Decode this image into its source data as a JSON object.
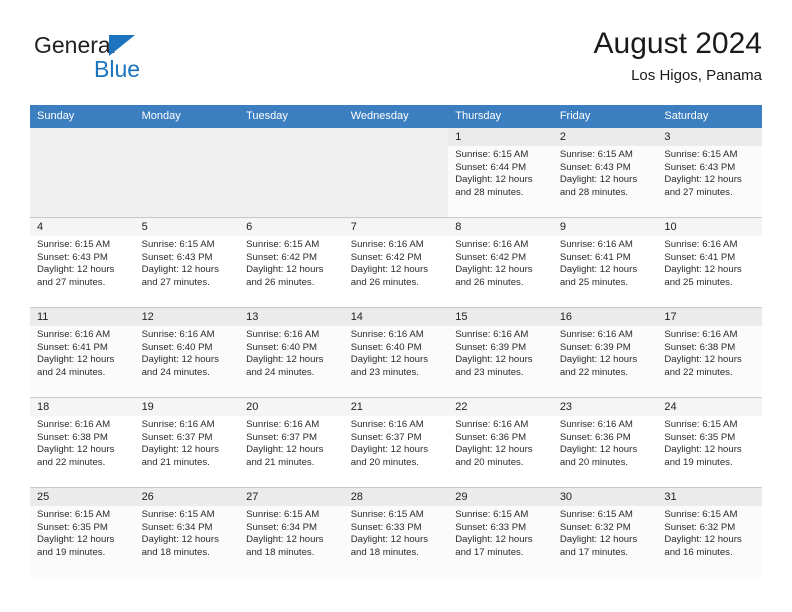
{
  "brand": {
    "name_part1": "General",
    "name_part2": "Blue",
    "logo_icon": "triangle-flag-icon"
  },
  "header": {
    "title": "August 2024",
    "subtitle": "Los Higos, Panama"
  },
  "calendar": {
    "weekday_headers": [
      "Sunday",
      "Monday",
      "Tuesday",
      "Wednesday",
      "Thursday",
      "Friday",
      "Saturday"
    ],
    "accent_color": "#3c7fc1",
    "weeks": [
      [
        {
          "day": "",
          "empty": true
        },
        {
          "day": "",
          "empty": true
        },
        {
          "day": "",
          "empty": true
        },
        {
          "day": "",
          "empty": true
        },
        {
          "day": "1",
          "sunrise": "Sunrise: 6:15 AM",
          "sunset": "Sunset: 6:44 PM",
          "daylight1": "Daylight: 12 hours",
          "daylight2": "and 28 minutes."
        },
        {
          "day": "2",
          "sunrise": "Sunrise: 6:15 AM",
          "sunset": "Sunset: 6:43 PM",
          "daylight1": "Daylight: 12 hours",
          "daylight2": "and 28 minutes."
        },
        {
          "day": "3",
          "sunrise": "Sunrise: 6:15 AM",
          "sunset": "Sunset: 6:43 PM",
          "daylight1": "Daylight: 12 hours",
          "daylight2": "and 27 minutes."
        }
      ],
      [
        {
          "day": "4",
          "sunrise": "Sunrise: 6:15 AM",
          "sunset": "Sunset: 6:43 PM",
          "daylight1": "Daylight: 12 hours",
          "daylight2": "and 27 minutes."
        },
        {
          "day": "5",
          "sunrise": "Sunrise: 6:15 AM",
          "sunset": "Sunset: 6:43 PM",
          "daylight1": "Daylight: 12 hours",
          "daylight2": "and 27 minutes."
        },
        {
          "day": "6",
          "sunrise": "Sunrise: 6:15 AM",
          "sunset": "Sunset: 6:42 PM",
          "daylight1": "Daylight: 12 hours",
          "daylight2": "and 26 minutes."
        },
        {
          "day": "7",
          "sunrise": "Sunrise: 6:16 AM",
          "sunset": "Sunset: 6:42 PM",
          "daylight1": "Daylight: 12 hours",
          "daylight2": "and 26 minutes."
        },
        {
          "day": "8",
          "sunrise": "Sunrise: 6:16 AM",
          "sunset": "Sunset: 6:42 PM",
          "daylight1": "Daylight: 12 hours",
          "daylight2": "and 26 minutes."
        },
        {
          "day": "9",
          "sunrise": "Sunrise: 6:16 AM",
          "sunset": "Sunset: 6:41 PM",
          "daylight1": "Daylight: 12 hours",
          "daylight2": "and 25 minutes."
        },
        {
          "day": "10",
          "sunrise": "Sunrise: 6:16 AM",
          "sunset": "Sunset: 6:41 PM",
          "daylight1": "Daylight: 12 hours",
          "daylight2": "and 25 minutes."
        }
      ],
      [
        {
          "day": "11",
          "sunrise": "Sunrise: 6:16 AM",
          "sunset": "Sunset: 6:41 PM",
          "daylight1": "Daylight: 12 hours",
          "daylight2": "and 24 minutes."
        },
        {
          "day": "12",
          "sunrise": "Sunrise: 6:16 AM",
          "sunset": "Sunset: 6:40 PM",
          "daylight1": "Daylight: 12 hours",
          "daylight2": "and 24 minutes."
        },
        {
          "day": "13",
          "sunrise": "Sunrise: 6:16 AM",
          "sunset": "Sunset: 6:40 PM",
          "daylight1": "Daylight: 12 hours",
          "daylight2": "and 24 minutes."
        },
        {
          "day": "14",
          "sunrise": "Sunrise: 6:16 AM",
          "sunset": "Sunset: 6:40 PM",
          "daylight1": "Daylight: 12 hours",
          "daylight2": "and 23 minutes."
        },
        {
          "day": "15",
          "sunrise": "Sunrise: 6:16 AM",
          "sunset": "Sunset: 6:39 PM",
          "daylight1": "Daylight: 12 hours",
          "daylight2": "and 23 minutes."
        },
        {
          "day": "16",
          "sunrise": "Sunrise: 6:16 AM",
          "sunset": "Sunset: 6:39 PM",
          "daylight1": "Daylight: 12 hours",
          "daylight2": "and 22 minutes."
        },
        {
          "day": "17",
          "sunrise": "Sunrise: 6:16 AM",
          "sunset": "Sunset: 6:38 PM",
          "daylight1": "Daylight: 12 hours",
          "daylight2": "and 22 minutes."
        }
      ],
      [
        {
          "day": "18",
          "sunrise": "Sunrise: 6:16 AM",
          "sunset": "Sunset: 6:38 PM",
          "daylight1": "Daylight: 12 hours",
          "daylight2": "and 22 minutes."
        },
        {
          "day": "19",
          "sunrise": "Sunrise: 6:16 AM",
          "sunset": "Sunset: 6:37 PM",
          "daylight1": "Daylight: 12 hours",
          "daylight2": "and 21 minutes."
        },
        {
          "day": "20",
          "sunrise": "Sunrise: 6:16 AM",
          "sunset": "Sunset: 6:37 PM",
          "daylight1": "Daylight: 12 hours",
          "daylight2": "and 21 minutes."
        },
        {
          "day": "21",
          "sunrise": "Sunrise: 6:16 AM",
          "sunset": "Sunset: 6:37 PM",
          "daylight1": "Daylight: 12 hours",
          "daylight2": "and 20 minutes."
        },
        {
          "day": "22",
          "sunrise": "Sunrise: 6:16 AM",
          "sunset": "Sunset: 6:36 PM",
          "daylight1": "Daylight: 12 hours",
          "daylight2": "and 20 minutes."
        },
        {
          "day": "23",
          "sunrise": "Sunrise: 6:16 AM",
          "sunset": "Sunset: 6:36 PM",
          "daylight1": "Daylight: 12 hours",
          "daylight2": "and 20 minutes."
        },
        {
          "day": "24",
          "sunrise": "Sunrise: 6:15 AM",
          "sunset": "Sunset: 6:35 PM",
          "daylight1": "Daylight: 12 hours",
          "daylight2": "and 19 minutes."
        }
      ],
      [
        {
          "day": "25",
          "sunrise": "Sunrise: 6:15 AM",
          "sunset": "Sunset: 6:35 PM",
          "daylight1": "Daylight: 12 hours",
          "daylight2": "and 19 minutes."
        },
        {
          "day": "26",
          "sunrise": "Sunrise: 6:15 AM",
          "sunset": "Sunset: 6:34 PM",
          "daylight1": "Daylight: 12 hours",
          "daylight2": "and 18 minutes."
        },
        {
          "day": "27",
          "sunrise": "Sunrise: 6:15 AM",
          "sunset": "Sunset: 6:34 PM",
          "daylight1": "Daylight: 12 hours",
          "daylight2": "and 18 minutes."
        },
        {
          "day": "28",
          "sunrise": "Sunrise: 6:15 AM",
          "sunset": "Sunset: 6:33 PM",
          "daylight1": "Daylight: 12 hours",
          "daylight2": "and 18 minutes."
        },
        {
          "day": "29",
          "sunrise": "Sunrise: 6:15 AM",
          "sunset": "Sunset: 6:33 PM",
          "daylight1": "Daylight: 12 hours",
          "daylight2": "and 17 minutes."
        },
        {
          "day": "30",
          "sunrise": "Sunrise: 6:15 AM",
          "sunset": "Sunset: 6:32 PM",
          "daylight1": "Daylight: 12 hours",
          "daylight2": "and 17 minutes."
        },
        {
          "day": "31",
          "sunrise": "Sunrise: 6:15 AM",
          "sunset": "Sunset: 6:32 PM",
          "daylight1": "Daylight: 12 hours",
          "daylight2": "and 16 minutes."
        }
      ]
    ]
  }
}
